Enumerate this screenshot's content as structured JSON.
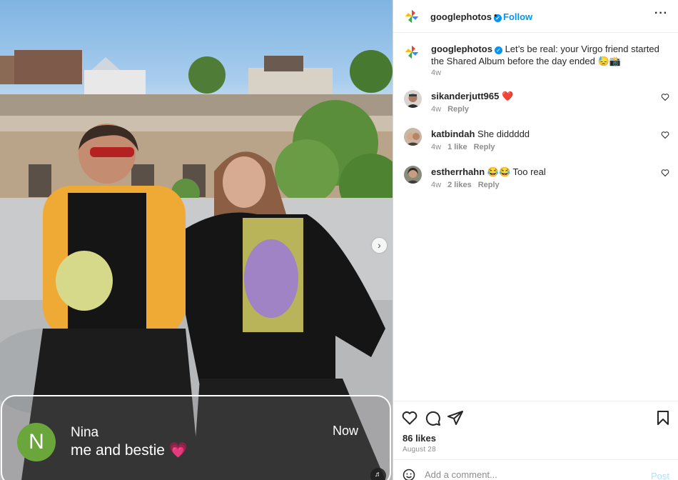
{
  "photo": {
    "next_arrow": "›",
    "notification": {
      "avatar_letter": "N",
      "sender": "Nina",
      "message": "me and bestie",
      "message_emoji": "💗",
      "time": "Now"
    },
    "sound_icon": "speaker-icon"
  },
  "post": {
    "header": {
      "username": "googlephotos",
      "verified_mark": "✓",
      "separator": "•",
      "follow_label": "Follow",
      "more_label": "···"
    },
    "caption": {
      "username": "googlephotos",
      "text": "Let’s be real: your Virgo friend started the Shared Album before the day ended 😓📸",
      "age": "4w"
    },
    "comments": [
      {
        "username": "sikanderjutt965",
        "text": "",
        "emoji": "❤️",
        "age": "4w",
        "likes": "",
        "reply": "Reply"
      },
      {
        "username": "katbindah",
        "text": "She diddddd",
        "emoji": "",
        "age": "4w",
        "likes": "1 like",
        "reply": "Reply"
      },
      {
        "username": "estherrhahn",
        "text": "😂😂 Too real",
        "emoji": "",
        "age": "4w",
        "likes": "2 likes",
        "reply": "Reply"
      }
    ],
    "likes": "86 likes",
    "date": "August 28",
    "comment_box": {
      "placeholder": "Add a comment...",
      "post_label": "Post"
    }
  },
  "colors": {
    "accent_blue": "#0095f6",
    "post_disabled": "#b2dffc",
    "muted_text": "#8e8e8e",
    "notification_avatar": "#6aa63c"
  }
}
